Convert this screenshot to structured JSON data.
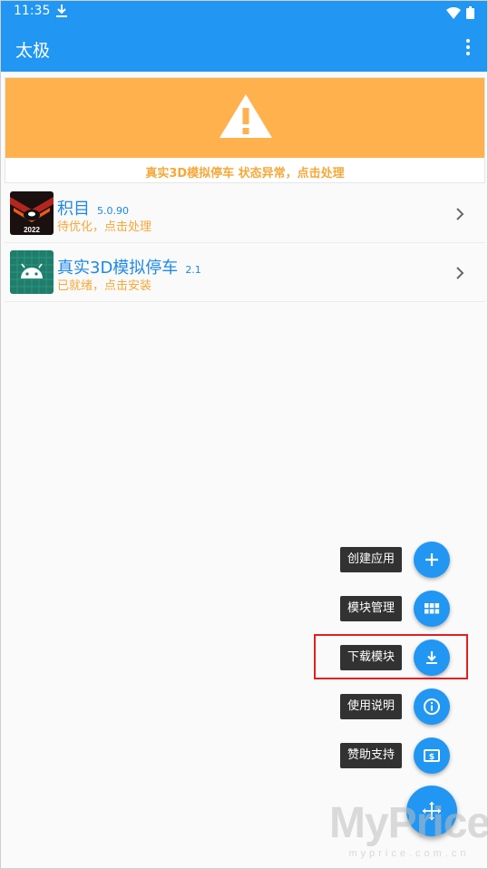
{
  "status_bar": {
    "time": "11:35"
  },
  "app_bar": {
    "title": "太极"
  },
  "warning": {
    "text": "真实3D模拟停车 状态异常，点击处理"
  },
  "modules": [
    {
      "name": "积目",
      "version": "5.0.90",
      "status": "待优化，点击处理",
      "badge": "2022"
    },
    {
      "name": "真实3D模拟停车",
      "version": "2.1",
      "status": "已就绪，点击安装"
    }
  ],
  "fab_menu": {
    "items": [
      {
        "label": "创建应用",
        "icon": "plus-icon"
      },
      {
        "label": "模块管理",
        "icon": "grid-icon"
      },
      {
        "label": "下载模块",
        "icon": "download-icon"
      },
      {
        "label": "使用说明",
        "icon": "info-icon"
      },
      {
        "label": "赞助支持",
        "icon": "dollar-card-icon"
      }
    ],
    "main_icon": "move-arrows-icon",
    "highlighted": "下载模块"
  },
  "watermark": {
    "big": "MyPrice",
    "small": "myprice.com.cn"
  },
  "colors": {
    "primary": "#2196f3",
    "warning": "#ffb14e",
    "status_text": "#f5a83a",
    "highlight": "#e02020"
  }
}
